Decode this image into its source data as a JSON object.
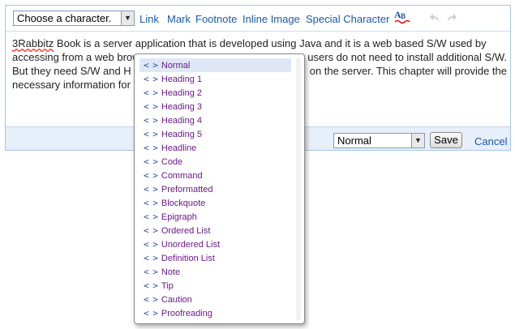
{
  "toolbar": {
    "character_select": {
      "value": "Choose a character."
    },
    "links": [
      "Link",
      "Mark",
      "Footnote",
      "Inline Image",
      "Special Character"
    ],
    "icons": {
      "spellcheck": "spellcheck-icon",
      "undo": "undo-icon",
      "redo": "redo-icon"
    }
  },
  "content": {
    "misspelled_word": "3Rabbitz",
    "line1_rest": " Book is a server application that is developed using Java and it is a web based S/W used by",
    "line2": "accessing from a web brow",
    "line2_tail": "users do not need to install additional S/W.",
    "line3": "But they need S/W and H",
    "line3_tail": "on the server. This chapter will provide the",
    "line4": "necessary information for t"
  },
  "bottombar": {
    "style_select": {
      "value": "Normal"
    },
    "save_label": "Save",
    "cancel_label": "Cancel"
  },
  "style_menu": {
    "tag_symbol": "< >",
    "selected_index": 0,
    "items": [
      "Normal",
      "Heading 1",
      "Heading 2",
      "Heading 3",
      "Heading 4",
      "Heading 5",
      "Headline",
      "Code",
      "Command",
      "Preformatted",
      "Blockquote",
      "Epigraph",
      "Ordered List",
      "Unordered List",
      "Definition List",
      "Note",
      "Tip",
      "Caution",
      "Proofreading"
    ]
  },
  "colors": {
    "link": "#1a5aa9",
    "menu_text": "#6a1b86",
    "menu_tag": "#2a4ea8",
    "frame_border": "#a9c6e6",
    "bottom_bar": "#e6effa"
  }
}
